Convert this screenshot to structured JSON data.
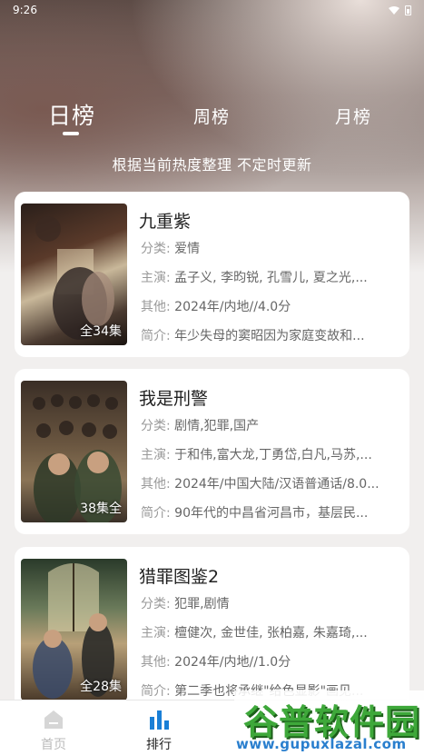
{
  "status": {
    "time": "9:26"
  },
  "tabs": [
    {
      "label": "日榜",
      "active": true
    },
    {
      "label": "周榜",
      "active": false
    },
    {
      "label": "月榜",
      "active": false
    }
  ],
  "subtitle": "根据当前热度整理 不定时更新",
  "labels": {
    "genre": "分类:",
    "cast": "主演:",
    "other": "其他:",
    "intro": "简介:"
  },
  "items": [
    {
      "title": "九重紫",
      "genre": "爱情",
      "cast": "孟子义, 李昀锐, 孔雪儿, 夏之光,...",
      "other": "2024年/内地//4.0分",
      "intro": "年少失母的窦昭因为家庭变故和...",
      "episodes": "全34集",
      "poster_colors": [
        "#3a2a22",
        "#8a5a3a",
        "#c9b79a"
      ]
    },
    {
      "title": "我是刑警",
      "genre": "剧情,犯罪,国产",
      "cast": "于和伟,富大龙,丁勇岱,白凡,马苏,...",
      "other": "2024年/中国大陆/汉语普通话/8.0...",
      "intro": "90年代的中昌省河昌市，基层民...",
      "episodes": "38集全",
      "poster_colors": [
        "#2a2420",
        "#6a5a48",
        "#b09a78"
      ]
    },
    {
      "title": "猎罪图鉴2",
      "genre": "犯罪,剧情",
      "cast": "檀健次, 金世佳, 张柏嘉, 朱嘉琦,...",
      "other": "2024年/内地//1.0分",
      "intro": "第二季也将承继\"给色显影\"画见...",
      "episodes": "全28集",
      "poster_colors": [
        "#2c3a2a",
        "#8a7050",
        "#d0b890"
      ]
    }
  ],
  "nav": [
    {
      "label": "首页",
      "icon": "home-icon",
      "active": false
    },
    {
      "label": "排行",
      "icon": "ranking-icon",
      "active": true
    }
  ],
  "watermark": {
    "title": "谷普软件园",
    "url": "www.gupuxlazal.com"
  },
  "colors": {
    "accent": "#1a7fd6",
    "nav_inactive": "#bbbbbb"
  }
}
